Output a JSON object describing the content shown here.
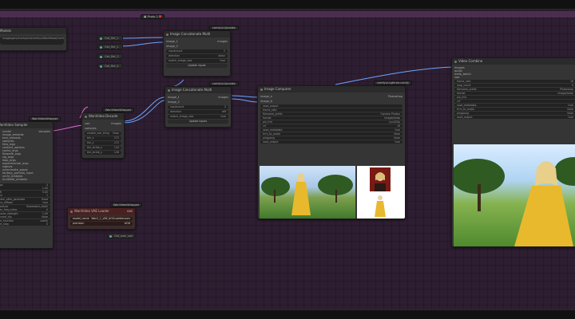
{
  "app": {
    "name": "ComfyUI node graph"
  },
  "colors": {
    "canvas": "#2e1e31",
    "group_band": "#4a2e4f",
    "wire_blue": "#6aa6ff",
    "wire_pink": "#e070d0",
    "vae_node": "#4a2020"
  },
  "top_node": {
    "title": "Photo 2",
    "icon": "image-icon"
  },
  "models_node": {
    "title": "Models",
    "text": "imagesgen/checkpoint/comfyui/Workflows/ComfyUI"
  },
  "get_nodes": [
    "Get_Ref_1",
    "Get_Ref_2",
    "Get_Ref_3",
    "Get_Ref_4"
  ],
  "concat_multi": {
    "badge": "comfyui-kjnodes",
    "title": "Image Concatenate Multi",
    "inputs": [
      "image_1",
      "image_2"
    ],
    "output": "images",
    "widgets": [
      [
        "inputcount",
        "2"
      ],
      [
        "direction",
        "down"
      ],
      [
        "match_image_size",
        "true"
      ]
    ],
    "button": "Update inputs"
  },
  "concat_multi2": {
    "badge": "comfyui-kjnodes",
    "title": "Image Concatenate Multi",
    "inputs": [
      "image_1",
      "image_2"
    ],
    "output": "images",
    "widgets": [
      [
        "inputcount",
        "2"
      ],
      [
        "direction",
        "left"
      ],
      [
        "match_image_size",
        "true"
      ]
    ],
    "button": "Update inputs"
  },
  "wan_decode": {
    "badge": "WanVideoWrapper",
    "title": "WanVideo Decode",
    "inputs": [
      "vae",
      "samples"
    ],
    "output": "images",
    "widgets": [
      [
        "enable_vae_tiling",
        "false"
      ],
      [
        "tile_x",
        "272"
      ],
      [
        "tile_y",
        "272"
      ],
      [
        "tile_stride_x",
        "144"
      ],
      [
        "tile_stride_y",
        "128"
      ]
    ]
  },
  "sampler": {
    "badge": "WanVideoWrapper",
    "title": "WanVideo Sampler",
    "inputs": [
      "model",
      "image_embeds",
      "text_embeds",
      "samples",
      "feta_args",
      "context_options",
      "cache_args",
      "flowedit_args",
      "slg_args",
      "loop_args",
      "experimental_args",
      "sigmas",
      "unianimate_poses",
      "fantasy_portrait_input",
      "uni3c_embeds",
      "multitalk_embeds"
    ],
    "output": "samples",
    "widgets": [
      [
        "steps",
        "4"
      ],
      [
        "cfg",
        "1.00"
      ],
      [
        "shift",
        "5.00"
      ],
      [
        "seed",
        "1"
      ],
      [
        "control_after_generate",
        "fixed"
      ],
      [
        "force_offload",
        "true"
      ],
      [
        "scheduler",
        "flowmatch_distill"
      ],
      [
        "riflex_freq_index",
        "0"
      ],
      [
        "denoise_strength",
        "1.00"
      ],
      [
        "batched_cfg",
        "false"
      ],
      [
        "rope_function",
        "comfy"
      ],
      [
        "start_step",
        "0"
      ],
      [
        "end_step",
        "-1"
      ],
      [
        "add_noise_to_samples",
        "false"
      ]
    ]
  },
  "vae_loader": {
    "badge": "WanVideoWrapper",
    "title": "WanVideo VAE Loader",
    "output": "vae",
    "widgets": [
      [
        "model_name",
        "Wan2_1_VAE_bf16.safetensors"
      ],
      [
        "precision",
        "bf16"
      ]
    ]
  },
  "get_vae": "Get_wan_vae",
  "compare": {
    "badge": "comfyui-rgthree-comfy",
    "title": "Image Comparer",
    "inputs": [
      "image_a",
      "image_b"
    ],
    "widgets": [
      [
        "filename_prefix",
        "Photoshop"
      ],
      [
        "image_1",
        ""
      ],
      [
        "image_2",
        ""
      ]
    ]
  },
  "video_combine": {
    "title": "Video Combine",
    "inputs": [
      "images",
      "audio",
      "meta_batch",
      "vae"
    ],
    "widgets": [
      [
        "frame_rate",
        "16"
      ],
      [
        "loop_count",
        "0"
      ],
      [
        "filename_prefix",
        "Photoshop"
      ],
      [
        "format",
        "image/webp"
      ],
      [
        "pix_fmt",
        ""
      ],
      [
        "crf",
        ""
      ],
      [
        "save_metadata",
        "true"
      ],
      [
        "trim_to_audio",
        "false"
      ],
      [
        "pingpong",
        "false"
      ],
      [
        "save_output",
        "true"
      ]
    ]
  },
  "compare_mid": {
    "labels": [
      [
        "save_output",
        ""
      ],
      [
        "frame_rate",
        ""
      ],
      [
        "filename_prefix",
        "Camera Photon"
      ],
      [
        "format",
        "image/webp"
      ],
      [
        "pix_fmt",
        "yuv420p"
      ],
      [
        "crf",
        "19"
      ],
      [
        "save_metadata",
        "true"
      ],
      [
        "trim_to_audio",
        "false"
      ],
      [
        "pingpong",
        "false"
      ],
      [
        "save_output",
        "true"
      ]
    ]
  }
}
